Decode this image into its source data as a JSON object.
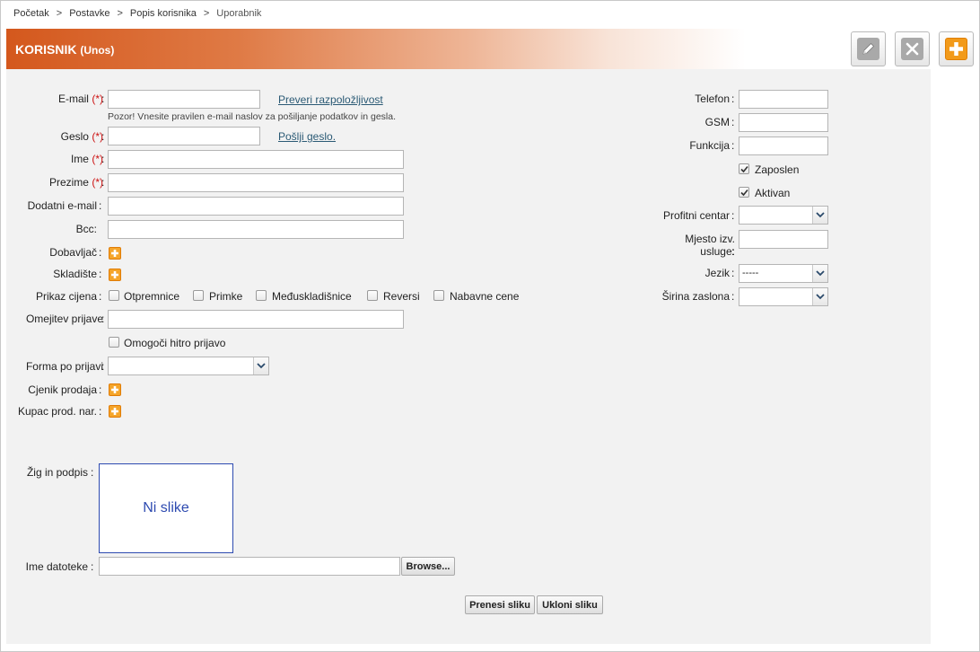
{
  "breadcrumb": {
    "items": [
      "Početak",
      "Postavke",
      "Popis korisnika",
      "Uporabnik"
    ],
    "separator": ">"
  },
  "header": {
    "title": "KORISNIK",
    "subtitle": "(Unos)",
    "gradient_from": "#d4581d",
    "toolbar": {
      "edit_icon": "pencil-icon",
      "close_icon": "close-icon",
      "add_icon": "plus-icon"
    }
  },
  "form": {
    "required_marker": "(*)",
    "email": {
      "label": "E-mail",
      "value": "",
      "check_link": "Preveri razpoložljivost",
      "hint": "Pozor! Vnesite pravilen e-mail naslov za pošiljanje podatkov in gesla."
    },
    "password": {
      "label": "Geslo",
      "value": "",
      "send_link": "Pošlji geslo."
    },
    "first_name": {
      "label": "Ime",
      "value": ""
    },
    "last_name": {
      "label": "Prezime",
      "value": ""
    },
    "extra_email": {
      "label": "Dodatni e-mail",
      "value": ""
    },
    "bcc": {
      "label": "Bcc:",
      "value": ""
    },
    "supplier": {
      "label": "Dobavljač"
    },
    "warehouse": {
      "label": "Skladište"
    },
    "price_display": {
      "label": "Prikaz cijena",
      "options": [
        {
          "label": "Otpremnice",
          "checked": false
        },
        {
          "label": "Primke",
          "checked": false
        },
        {
          "label": "Međuskladišnice",
          "checked": false
        },
        {
          "label": "Reversi",
          "checked": false
        },
        {
          "label": "Nabavne cene",
          "checked": false
        }
      ]
    },
    "login_limit": {
      "label": "Omejitev prijave",
      "value": ""
    },
    "quick_login": {
      "label": "Omogoči hitro prijavo",
      "checked": false
    },
    "form_after_login": {
      "label": "Forma po prijavi",
      "value": ""
    },
    "sales_pricelist": {
      "label": "Cjenik prodaja"
    },
    "customer_order": {
      "label": "Kupac prod. nar."
    },
    "stamp": {
      "label": "Žig in podpis",
      "placeholder_text": "Ni slike"
    },
    "file_name": {
      "label": "Ime datoteke",
      "value": "",
      "browse_label": "Browse..."
    },
    "upload_label": "Prenesi sliku",
    "remove_label": "Ukloni sliku"
  },
  "right": {
    "phone": {
      "label": "Telefon",
      "value": ""
    },
    "gsm": {
      "label": "GSM",
      "value": ""
    },
    "function": {
      "label": "Funkcija",
      "value": ""
    },
    "employed": {
      "label": "Zaposlen",
      "checked": true
    },
    "active": {
      "label": "Aktivan",
      "checked": true
    },
    "profit_center": {
      "label": "Profitni centar",
      "value": ""
    },
    "service_place": {
      "label_line1": "Mjesto izv.",
      "label_line2": "usluge:",
      "value": ""
    },
    "language": {
      "label": "Jezik",
      "value": "-----"
    },
    "screen_width": {
      "label": "Širina zaslona",
      "value": ""
    }
  },
  "colon": ":",
  "colors": {
    "required": "#cc1111",
    "link": "#2b5a75",
    "accent": "#f29a1a",
    "image_border": "#2d4ab0"
  }
}
